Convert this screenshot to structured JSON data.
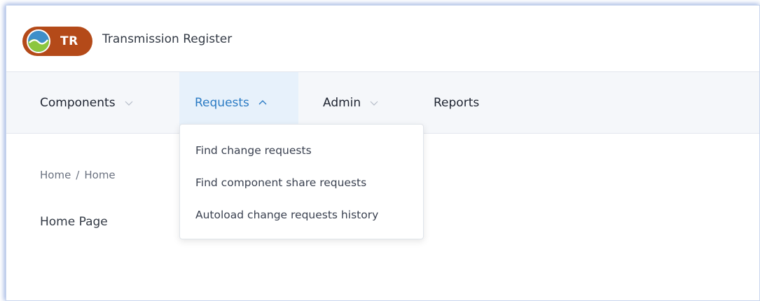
{
  "header": {
    "logo_text": "TR",
    "app_title": "Transmission Register",
    "brand_color": "#b44a19"
  },
  "nav": {
    "items": [
      {
        "label": "Components",
        "chevron": "chevron-down-icon"
      },
      {
        "label": "Requests",
        "chevron": "chevron-up-icon",
        "active": true
      },
      {
        "label": "Admin",
        "chevron": "chevron-down-icon"
      },
      {
        "label": "Reports"
      }
    ],
    "active_color": "#2b7bc4"
  },
  "dropdown": {
    "items": [
      {
        "label": "Find change requests"
      },
      {
        "label": "Find component share requests"
      },
      {
        "label": "Autoload change requests history"
      }
    ]
  },
  "breadcrumb": {
    "items": [
      "Home",
      "Home"
    ],
    "separator": "/"
  },
  "main": {
    "page_title": "Home Page"
  }
}
